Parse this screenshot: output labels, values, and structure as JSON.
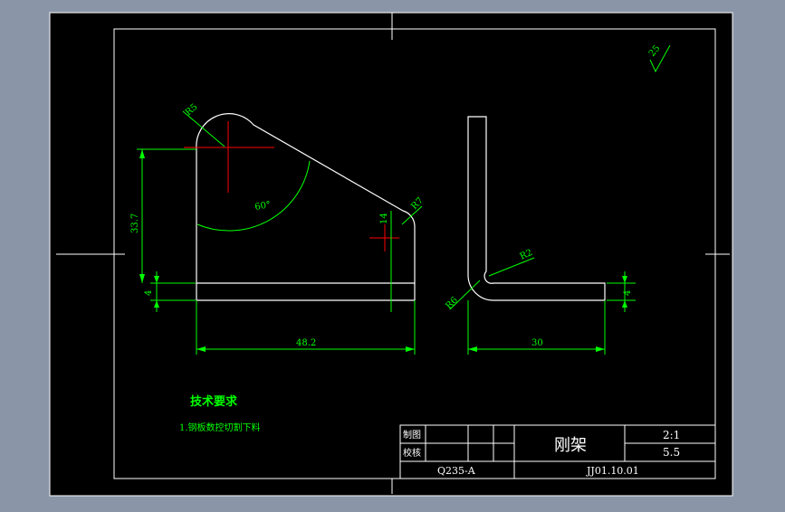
{
  "dimensions": {
    "angle_r_top": "R5",
    "angle_60": "60°",
    "height_33_7": "33.7",
    "thickness_left": "4",
    "dim_14": "14",
    "r_r7": "R7",
    "width_48_2": "48.2",
    "r_r2": "R2",
    "r_r6": "R6",
    "thickness_right": "4",
    "width_30": "30"
  },
  "roughness": {
    "value": "25"
  },
  "tech_requirements": {
    "heading": "技术要求",
    "items": [
      "1.钢板数控切割下料"
    ]
  },
  "title_block": {
    "label_drawn": "制图",
    "label_checked": "校核",
    "part_name": "刚架",
    "scale": "2:1",
    "weight": "5.5",
    "material": "Q235-A",
    "drawing_number": "JJ01.10.01"
  },
  "colors": {
    "background": "#8a96a8",
    "sheet": "#000000",
    "geometry": "#ffffff",
    "dimension": "#00ff00",
    "centerline": "#ff0000"
  }
}
